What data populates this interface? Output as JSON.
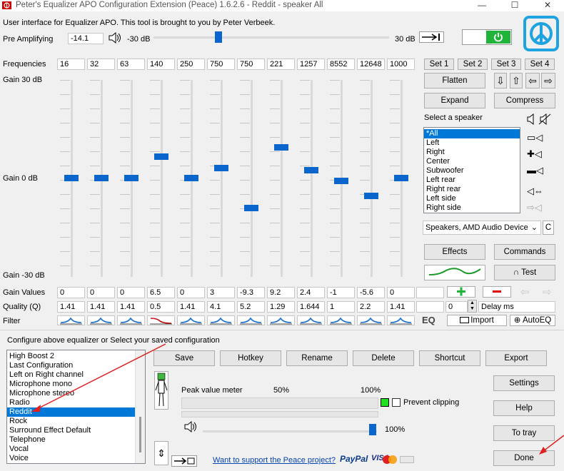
{
  "title": "Peter's Equalizer APO Configuration Extension (Peace) 1.6.2.6 - Reddit - speaker All",
  "window_controls": {
    "minimize": "—",
    "maximize": "☐",
    "close": "✕"
  },
  "header": {
    "description": "User interface for Equalizer APO. This tool is brought to you by Peter Verbeek.",
    "pre_amp_label": "Pre Amplifying",
    "pre_amp_value": "-14.1",
    "pre_amp_min": "-30 dB",
    "pre_amp_max": "30 dB"
  },
  "eq": {
    "frequencies_label": "Frequencies",
    "gain_top_label": "Gain 30 dB",
    "gain_mid_label": "Gain 0 dB",
    "gain_bottom_label": "Gain -30 dB",
    "gain_values_label": "Gain Values",
    "quality_label": "Quality (Q)",
    "filter_label": "Filter",
    "bands": [
      {
        "freq": "16",
        "gain": "0",
        "q": "1.41",
        "gain_db": 0
      },
      {
        "freq": "32",
        "gain": "0",
        "q": "1.41",
        "gain_db": 0
      },
      {
        "freq": "63",
        "gain": "0",
        "q": "1.41",
        "gain_db": 0
      },
      {
        "freq": "140",
        "gain": "6.5",
        "q": "0.5",
        "gain_db": 6.5
      },
      {
        "freq": "250",
        "gain": "0",
        "q": "1.41",
        "gain_db": 0
      },
      {
        "freq": "750",
        "gain": "3",
        "q": "4.1",
        "gain_db": 3
      },
      {
        "freq": "750",
        "gain": "-9.3",
        "q": "5.2",
        "gain_db": -9.3
      },
      {
        "freq": "221",
        "gain": "9.2",
        "q": "1.29",
        "gain_db": 9.2
      },
      {
        "freq": "1257",
        "gain": "2.4",
        "q": "1.644",
        "gain_db": 2.4
      },
      {
        "freq": "8552",
        "gain": "-1",
        "q": "1",
        "gain_db": -1
      },
      {
        "freq": "12648",
        "gain": "-5.6",
        "q": "2.2",
        "gain_db": -5.6
      },
      {
        "freq": "1000",
        "gain": "0",
        "q": "1.41",
        "gain_db": 0
      }
    ],
    "delay_value": "0",
    "delay_label": "Delay ms",
    "eq_label": "EQ",
    "import_label": "Import",
    "autoeq_label": "AutoEQ"
  },
  "sets": [
    "Set 1",
    "Set 2",
    "Set 3",
    "Set 4"
  ],
  "side": {
    "flatten": "Flatten",
    "expand": "Expand",
    "compress": "Compress",
    "select_speaker_label": "Select a speaker",
    "speakers": [
      "*All",
      "Left",
      "Right",
      "Center",
      "Subwoofer",
      "Left rear",
      "Right rear",
      "Left side",
      "Right side"
    ],
    "selected_speaker": "*All",
    "device": "Speakers, AMD Audio Device",
    "c_button": "C",
    "effects": "Effects",
    "commands": "Commands",
    "test": "Test"
  },
  "config": {
    "label": "Configure above equalizer or Select your saved configuration",
    "items": [
      "High Boost 2",
      "Last Configuration",
      "Left on Right channel",
      "Microphone mono",
      "Microphone stereo",
      "Radio",
      "Reddit",
      "Rock",
      "Surround Effect Default",
      "Telephone",
      "Vocal",
      "Voice"
    ],
    "selected": "Reddit"
  },
  "actions": [
    "Save",
    "Hotkey",
    "Rename",
    "Delete",
    "Shortcut",
    "Export"
  ],
  "meter": {
    "label": "Peak value meter",
    "mark_50": "50%",
    "mark_100": "100%",
    "prevent_clipping": "Prevent clipping",
    "volume_percent": "100%"
  },
  "support_link": "Want to support the Peace project?",
  "payments": {
    "paypal": "PayPal",
    "visa": "VISA"
  },
  "right_buttons": [
    "Settings",
    "Help",
    "To tray",
    "Done"
  ],
  "colors": {
    "accent": "#0078d7",
    "thumb": "#0a66cc",
    "power": "#22b33b",
    "logo": "#1fa3e0",
    "annotation": "#e02020"
  }
}
